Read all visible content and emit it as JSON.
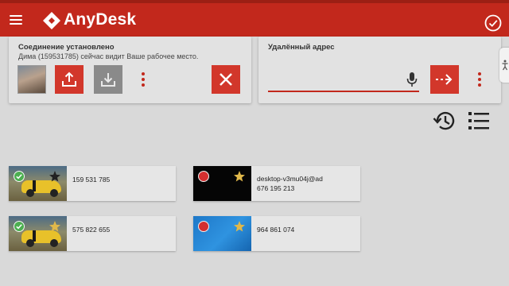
{
  "app": {
    "title": "AnyDesk",
    "brand_color": "#c2281c"
  },
  "session": {
    "title": "Соединение установлено",
    "subtitle": "Дима (159531785) сейчас видит Ваше рабочее место.",
    "buttons": [
      "upload-icon",
      "download-icon",
      "more-icon",
      "close-icon"
    ]
  },
  "remote": {
    "title": "Удалённый адрес",
    "input_value": "",
    "input_placeholder": ""
  },
  "toolbar": {
    "icons": [
      "history-icon",
      "list-view-icon"
    ]
  },
  "recent": [
    {
      "name": "",
      "id": "159 531 785",
      "online": true,
      "favorite": false,
      "thumbnail": "car"
    },
    {
      "name": "desktop-v3mu04j@ad",
      "id": "676 195 213",
      "online": false,
      "favorite": true,
      "thumbnail": "black"
    },
    {
      "name": "",
      "id": "575 822 655",
      "online": true,
      "favorite": true,
      "thumbnail": "car"
    },
    {
      "name": "",
      "id": "964 861 074",
      "online": false,
      "favorite": true,
      "thumbnail": "blue"
    }
  ]
}
